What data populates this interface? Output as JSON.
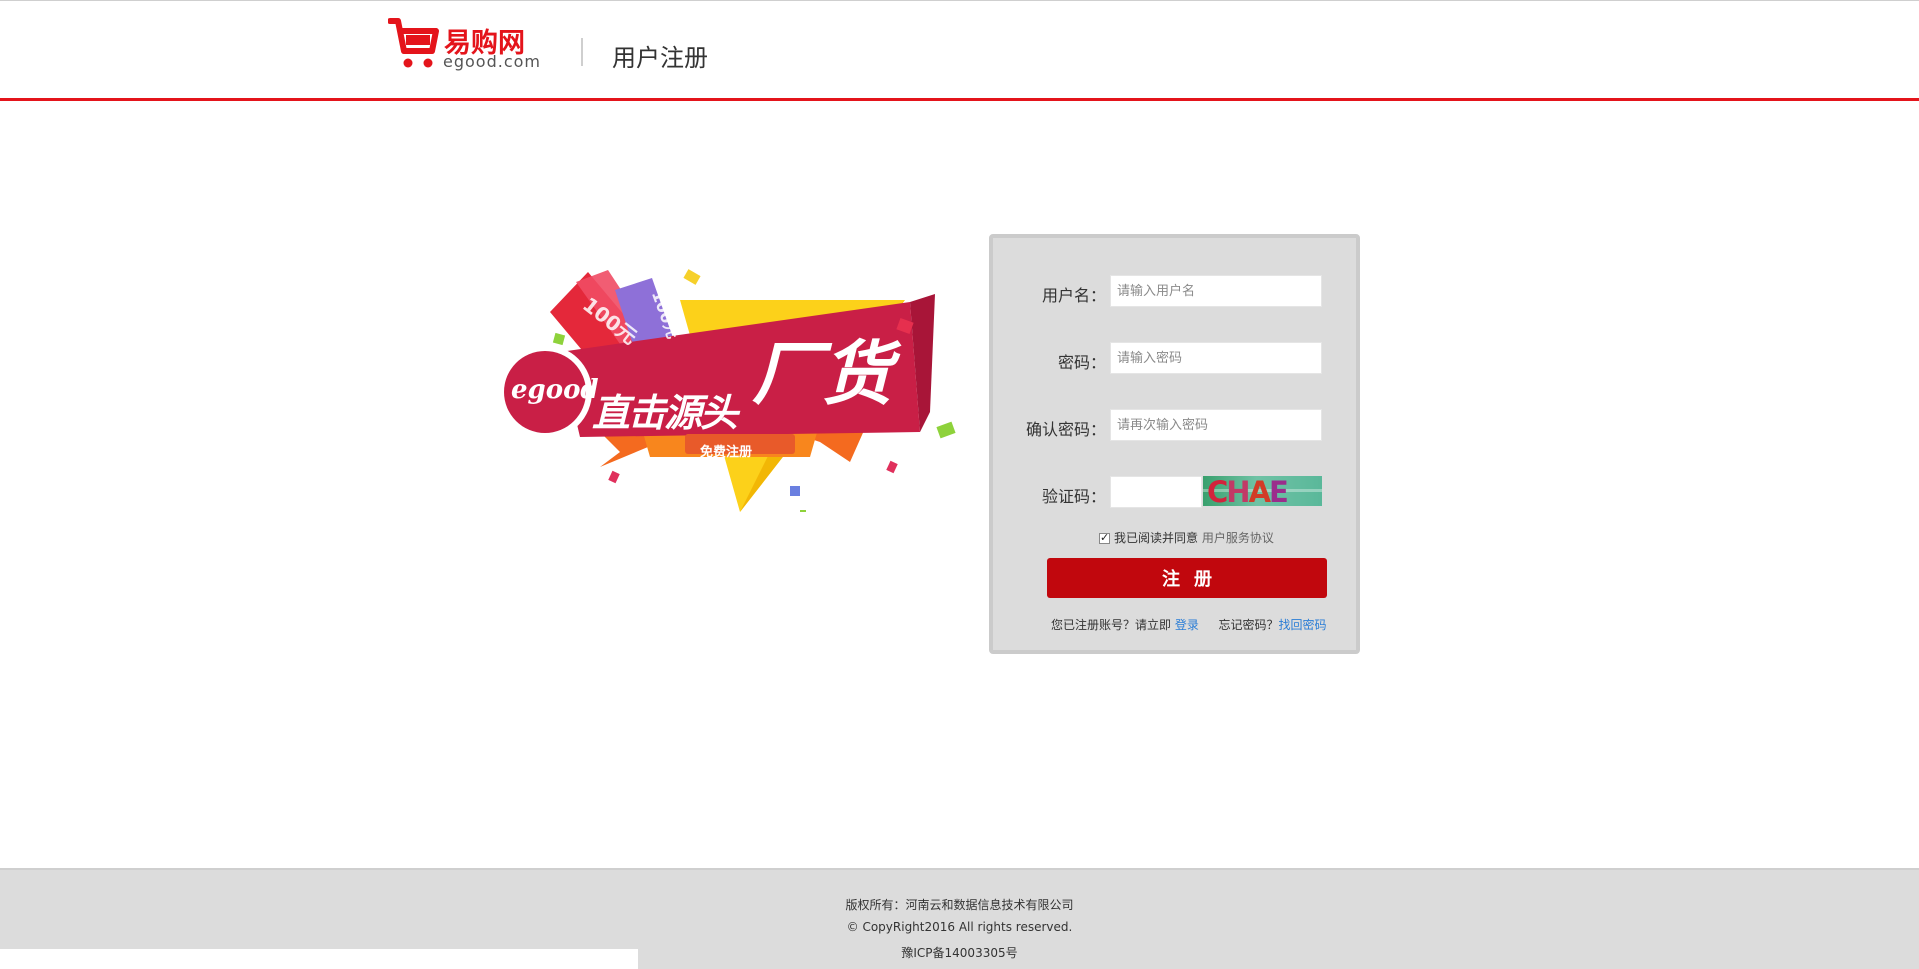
{
  "header": {
    "logo_cn": "易购网",
    "logo_en": "egood.com",
    "page_title": "用户注册"
  },
  "banner": {
    "brand_mark": "egood",
    "slogan": "直击源头",
    "big_char": "厂货",
    "caption": "免费注册",
    "ticket_1": "100元",
    "ticket_2": "100元"
  },
  "form": {
    "username": {
      "label": "用户名：",
      "placeholder": "请输入用户名",
      "value": ""
    },
    "password": {
      "label": "密码：",
      "placeholder": "请输入密码",
      "value": ""
    },
    "confirm_password": {
      "label": "确认密码：",
      "placeholder": "请再次输入密码",
      "value": ""
    },
    "captcha": {
      "label": "验证码：",
      "value": "",
      "image_text": [
        "C",
        "H",
        "A",
        "E"
      ]
    },
    "agree": {
      "checked": true,
      "text": "我已阅读并同意",
      "link": "用户服务协议"
    },
    "submit_label": "注册",
    "login_prompt": "您已注册账号？请立即",
    "login_link": "登录",
    "forgot_prompt": "忘记密码？",
    "forgot_link": "找回密码"
  },
  "footer": {
    "line1": "版权所有：河南云和数据信息技术有限公司",
    "line2": "© CopyRight2016 All rights reserved.",
    "line3": "豫ICP备14003305号"
  },
  "colors": {
    "brand_red": "#e4141b",
    "button_red": "#c1070d",
    "link_blue": "#2a7dd6",
    "panel_gray": "#dcdcdc"
  }
}
